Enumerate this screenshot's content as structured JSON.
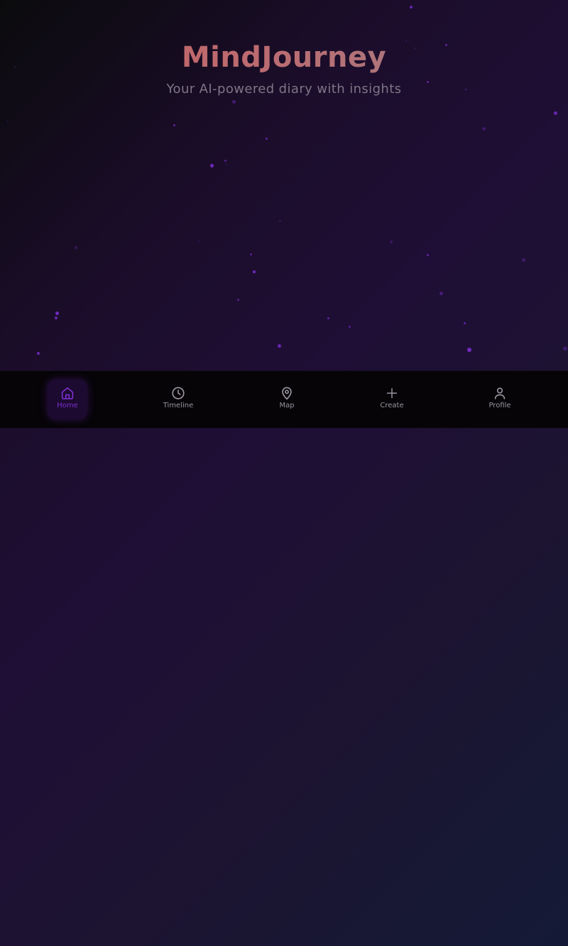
{
  "app": {
    "title": "MindJourney",
    "subtitle": "Your AI-powered diary with insights"
  },
  "nav": {
    "items": [
      {
        "label": "Home",
        "icon": "home-icon",
        "active": true
      },
      {
        "label": "Timeline",
        "icon": "clock-icon",
        "active": false
      },
      {
        "label": "Map",
        "icon": "map-pin-icon",
        "active": false
      },
      {
        "label": "Create",
        "icon": "plus-icon",
        "active": false
      },
      {
        "label": "Profile",
        "icon": "user-icon",
        "active": false
      }
    ]
  },
  "colors": {
    "accent": "#7b2fd1",
    "particle": "#7a2ccf",
    "nav_background": "#060407",
    "title_gradient_start": "#c86060",
    "title_gradient_end": "#9a8288"
  }
}
